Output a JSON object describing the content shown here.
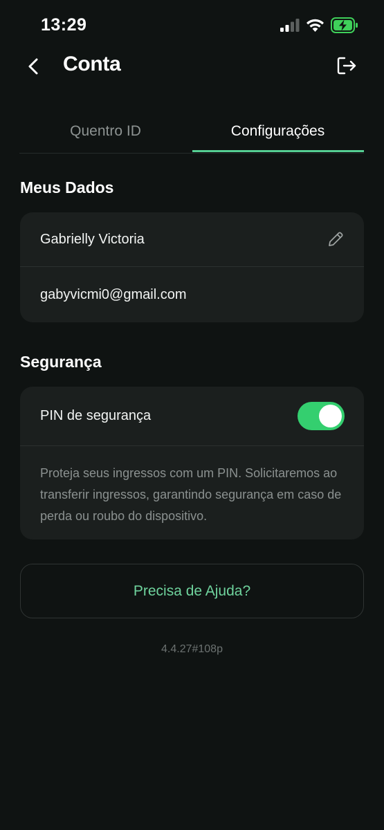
{
  "status_bar": {
    "time": "13:29",
    "icons": [
      "signal-icon",
      "wifi-icon",
      "battery-charging-icon"
    ]
  },
  "header": {
    "title": "Conta",
    "back_icon": "chevron-left-icon",
    "logout_icon": "logout-icon"
  },
  "tabs": [
    {
      "label": "Quentro ID",
      "active": false
    },
    {
      "label": "Configurações",
      "active": true
    }
  ],
  "my_data": {
    "title": "Meus Dados",
    "name": "Gabrielly Victoria",
    "email": "gabyvicmi0@gmail.com",
    "edit_icon": "pencil-icon"
  },
  "security": {
    "title": "Segurança",
    "pin_label": "PIN de segurança",
    "pin_enabled": true,
    "description": "Proteja seus ingressos com um PIN. Solicitaremos ao transferir ingressos, garantindo segurança em caso de perda ou roubo do dispositivo."
  },
  "help": {
    "label": "Precisa de Ajuda?"
  },
  "version": "4.4.27#108p",
  "colors": {
    "background": "#0f1312",
    "card": "#1b1f1e",
    "accent": "#55cf93",
    "toggle_on": "#34cf6f",
    "help_text": "#6fd39d"
  }
}
